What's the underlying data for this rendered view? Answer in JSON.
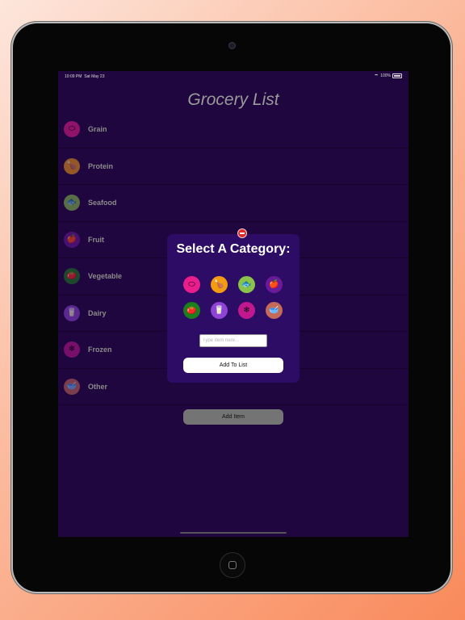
{
  "status_bar": {
    "time": "10:09 PM",
    "date": "Sat May 23",
    "battery": "100%"
  },
  "app_title": "Grocery List",
  "categories": [
    {
      "label": "Grain",
      "icon": "bread-icon",
      "glyph": "⬭",
      "color": "#e91e8c"
    },
    {
      "label": "Protein",
      "icon": "chicken-leg-icon",
      "glyph": "🍗",
      "color": "#f39c12"
    },
    {
      "label": "Seafood",
      "icon": "fish-icon",
      "glyph": "🐟",
      "color": "#8bc34a"
    },
    {
      "label": "Fruit",
      "icon": "apple-icon",
      "glyph": "🍎",
      "color": "#6a1b9a"
    },
    {
      "label": "Vegetable",
      "icon": "tomato-icon",
      "glyph": "🍅",
      "color": "#1b7f1b"
    },
    {
      "label": "Dairy",
      "icon": "milk-bottle-icon",
      "glyph": "🥛",
      "color": "#8e44d4"
    },
    {
      "label": "Frozen",
      "icon": "snowflake-box-icon",
      "glyph": "❄",
      "color": "#c2188f"
    },
    {
      "label": "Other",
      "icon": "mortar-bowl-icon",
      "glyph": "🥣",
      "color": "#c46a5a"
    }
  ],
  "add_item_label": "Add Item",
  "modal": {
    "title": "Select A Category:",
    "input_placeholder": "Type Item here...",
    "input_value": "",
    "add_to_list_label": "Add To List"
  }
}
